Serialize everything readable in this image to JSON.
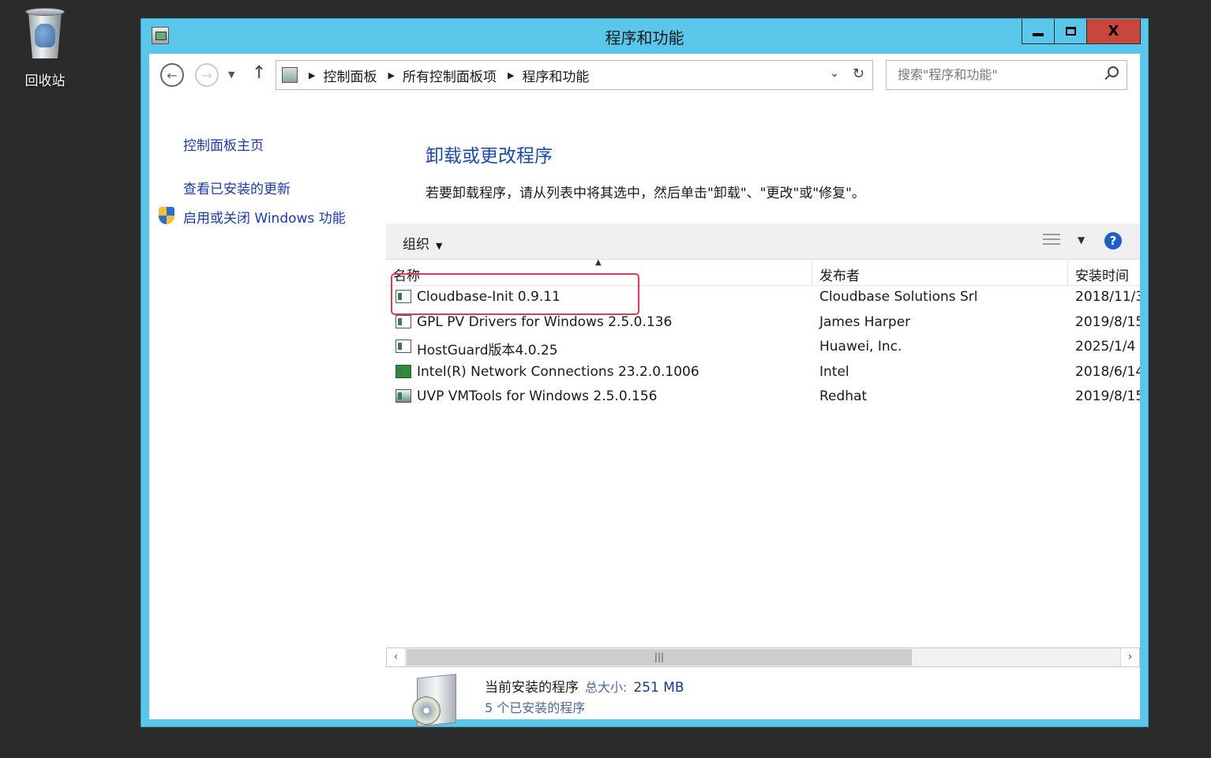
{
  "desktop": {
    "recycle_bin_label": "回收站"
  },
  "window": {
    "title": "程序和功能",
    "buttons": {
      "minimize": "",
      "maximize": "",
      "close": "X"
    }
  },
  "addressbar": {
    "breadcrumbs": [
      "控制面板",
      "所有控制面板项",
      "程序和功能"
    ],
    "search_placeholder": "搜索\"程序和功能\""
  },
  "sidebar": {
    "items": [
      {
        "label": "控制面板主页"
      },
      {
        "label": "查看已安装的更新"
      },
      {
        "label": "启用或关闭 Windows 功能"
      }
    ]
  },
  "main": {
    "title": "卸载或更改程序",
    "description": "若要卸载程序，请从列表中将其选中，然后单击\"卸载\"、\"更改\"或\"修复\"。",
    "toolbar": {
      "organize": "组织"
    },
    "columns": [
      "名称",
      "发布者",
      "安装时间"
    ],
    "programs": [
      {
        "name": "Cloudbase-Init 0.9.11",
        "publisher": "Cloudbase Solutions Srl",
        "date": "2018/11/3"
      },
      {
        "name": "GPL PV Drivers for Windows 2.5.0.136",
        "publisher": "James Harper",
        "date": "2019/8/15"
      },
      {
        "name": "HostGuard版本4.0.25",
        "publisher": "Huawei, Inc.",
        "date": "2025/1/4"
      },
      {
        "name": "Intel(R) Network Connections 23.2.0.1006",
        "publisher": "Intel",
        "date": "2018/6/14"
      },
      {
        "name": "UVP VMTools for Windows 2.5.0.156",
        "publisher": "Redhat",
        "date": "2019/8/15"
      }
    ]
  },
  "status": {
    "title": "当前安装的程序",
    "size_label": "总大小:",
    "size_value": "251 MB",
    "count": "5 个已安装的程序"
  },
  "colors": {
    "window_frame": "#5ac7ea",
    "link": "#1c3aa8",
    "highlight": "#e23c50",
    "close_button": "#c8463c"
  }
}
